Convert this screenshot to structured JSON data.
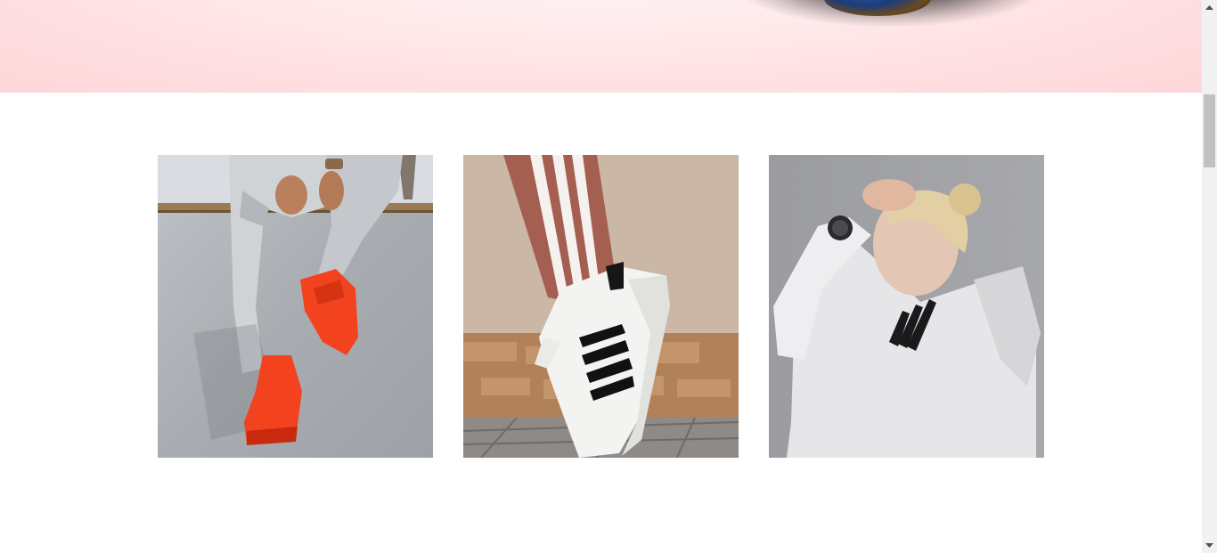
{
  "hero": {
    "background": "#ffe0e3",
    "image_subject": "shoe-sole-shadow"
  },
  "gallery": {
    "items": [
      {
        "subject": "red-sneakers-on-skate-ramp",
        "accent": "#f2431e"
      },
      {
        "subject": "white-sneaker-with-black-stripes",
        "accent": "#111111"
      },
      {
        "subject": "woman-in-white-hoodie",
        "accent": "#e8e8ea"
      }
    ]
  },
  "scrollbar": {
    "scroll_fraction": 0.18
  }
}
